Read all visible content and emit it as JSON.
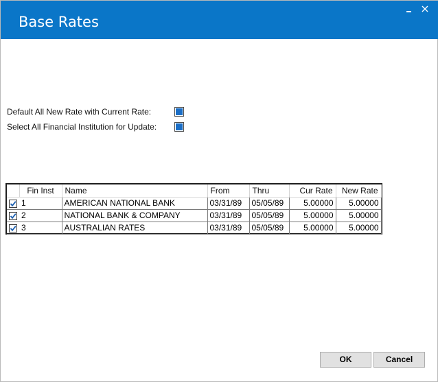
{
  "window": {
    "title": "Base Rates"
  },
  "options": {
    "default_label": "Default All New Rate with Current Rate:",
    "default_checked": true,
    "select_all_label": "Select All Financial Institution for Update:",
    "select_all_checked": true
  },
  "grid": {
    "columns": [
      "",
      "Fin Inst",
      "Name",
      "From",
      "Thru",
      "Cur Rate",
      "New Rate"
    ],
    "rows": [
      {
        "checked": true,
        "fin_inst": "1",
        "name": "AMERICAN NATIONAL BANK",
        "from": "03/31/89",
        "thru": "05/05/89",
        "cur_rate": "5.00000",
        "new_rate": "5.00000"
      },
      {
        "checked": true,
        "fin_inst": "2",
        "name": "NATIONAL BANK & COMPANY",
        "from": "03/31/89",
        "thru": "05/05/89",
        "cur_rate": "5.00000",
        "new_rate": "5.00000"
      },
      {
        "checked": true,
        "fin_inst": "3",
        "name": "AUSTRALIAN RATES",
        "from": "03/31/89",
        "thru": "05/05/89",
        "cur_rate": "5.00000",
        "new_rate": "5.00000"
      }
    ]
  },
  "buttons": {
    "ok": "OK",
    "cancel": "Cancel"
  },
  "colors": {
    "titlebar": "#0a76c8",
    "checkbox_fill": "#1b6ec6"
  },
  "icons": {
    "minimize": "minimize-icon",
    "close": "close-icon",
    "check": "check-icon"
  }
}
